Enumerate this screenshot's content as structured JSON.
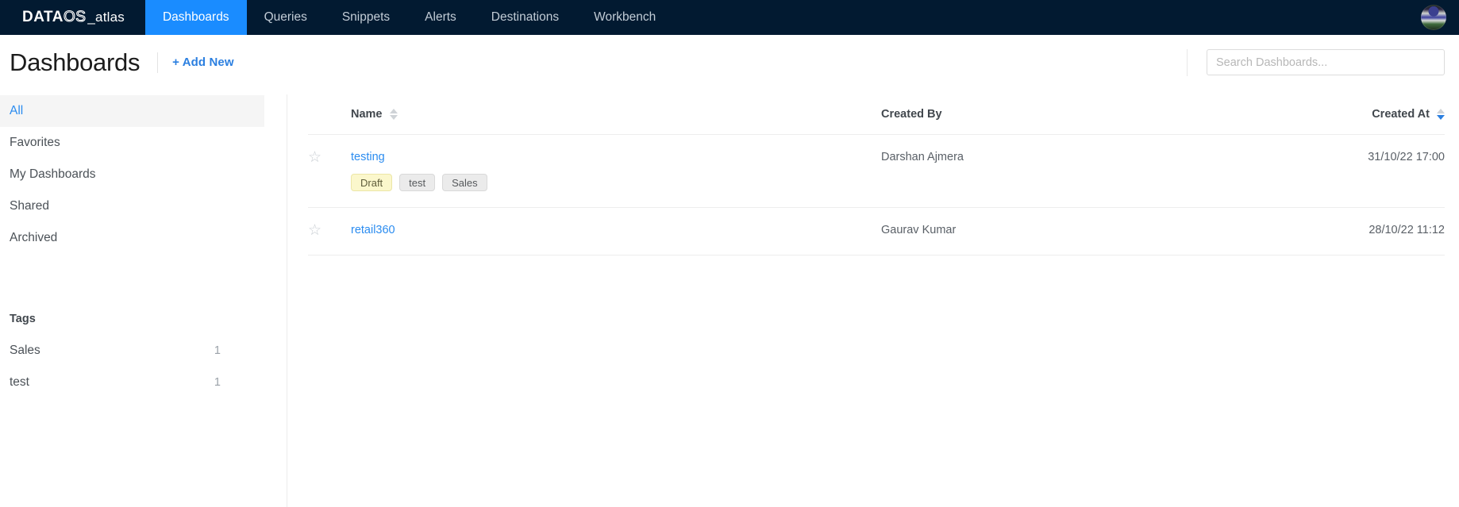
{
  "navbar": {
    "brand": {
      "part1": "DATA",
      "part2": "OS",
      "part3": "_atlas"
    },
    "items": [
      {
        "label": "Dashboards",
        "active": true
      },
      {
        "label": "Queries",
        "active": false
      },
      {
        "label": "Snippets",
        "active": false
      },
      {
        "label": "Alerts",
        "active": false
      },
      {
        "label": "Destinations",
        "active": false
      },
      {
        "label": "Workbench",
        "active": false
      }
    ],
    "avatar_icon": "user-avatar-icon",
    "active_color": "#1a8cff",
    "background": "#021a31"
  },
  "header": {
    "title": "Dashboards",
    "add_new_label": "+ Add New",
    "search_placeholder": "Search Dashboards...",
    "search_value": "",
    "link_color": "#2b7fe0"
  },
  "sidebar": {
    "items": [
      {
        "label": "All",
        "active": true
      },
      {
        "label": "Favorites",
        "active": false
      },
      {
        "label": "My Dashboards",
        "active": false
      },
      {
        "label": "Shared",
        "active": false
      },
      {
        "label": "Archived",
        "active": false
      }
    ],
    "tags_title": "Tags",
    "tags": [
      {
        "label": "Sales",
        "count": "1"
      },
      {
        "label": "test",
        "count": "1"
      }
    ]
  },
  "table": {
    "columns": {
      "star": "",
      "name": "Name",
      "created_by": "Created By",
      "created_at": "Created At"
    },
    "sort": {
      "column": "Created At",
      "direction": "desc"
    },
    "rows": [
      {
        "star_icon": "star-outline-icon",
        "name": "testing",
        "badges": [
          {
            "label": "Draft",
            "style": "draft"
          },
          {
            "label": "test",
            "style": "default"
          },
          {
            "label": "Sales",
            "style": "default"
          }
        ],
        "created_by": "Darshan Ajmera",
        "created_at": "31/10/22 17:00"
      },
      {
        "star_icon": "star-outline-icon",
        "name": "retail360",
        "badges": [],
        "created_by": "Gaurav Kumar",
        "created_at": "28/10/22 11:12"
      }
    ]
  }
}
